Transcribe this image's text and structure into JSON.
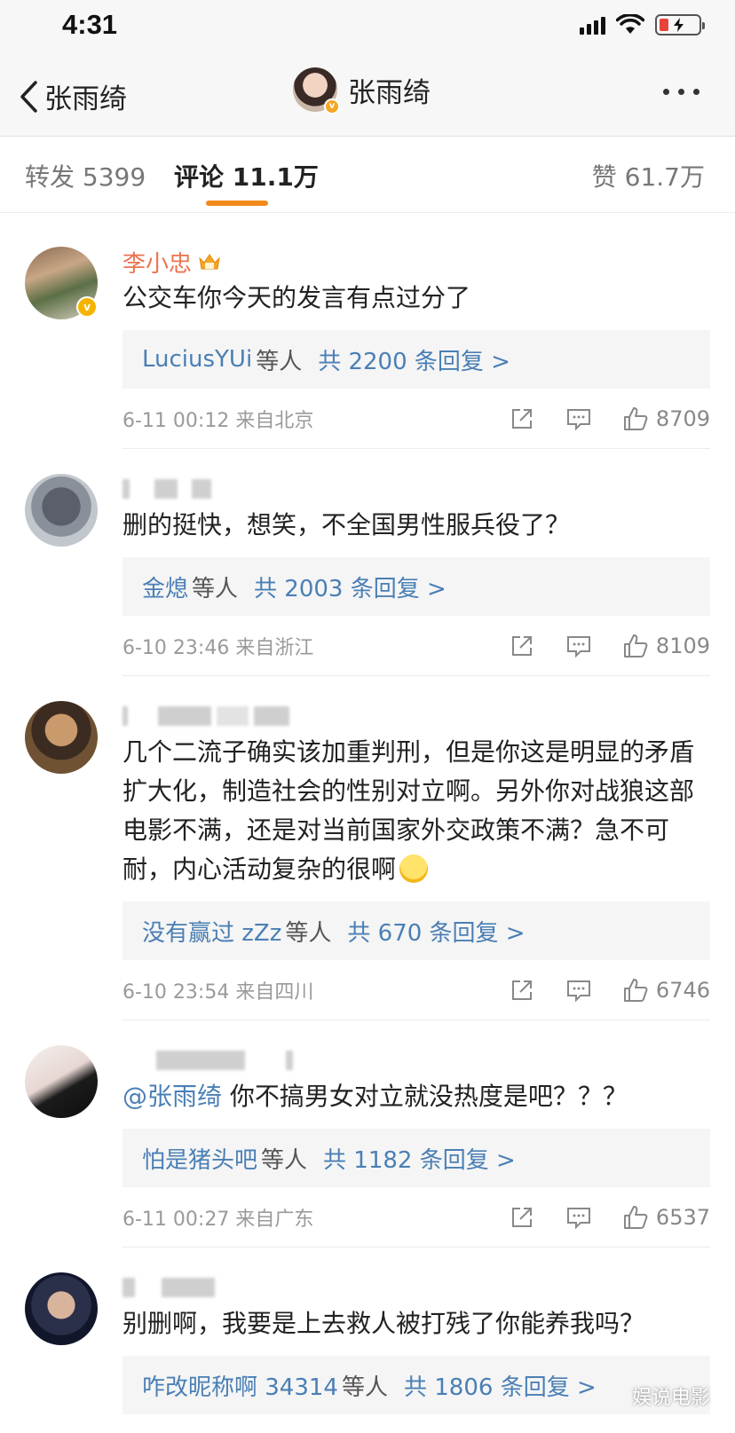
{
  "status_bar": {
    "time": "4:31"
  },
  "nav": {
    "back_label": "张雨绮",
    "title": "张雨绮"
  },
  "tabs": {
    "repost": "转发 5399",
    "comments": "评论 11.1万",
    "likes": "赞 61.7万"
  },
  "comments": [
    {
      "username": "李小忠",
      "text": "公交车你今天的发言有点过分了",
      "reply_users": "LuciusYUi",
      "reply_suffix": "等人",
      "reply_count": "共 2200 条回复 >",
      "time": "6-11 00:12  来自北京",
      "likes": "8709"
    },
    {
      "text": "删的挺快，想笑，不全国男性服兵役了？",
      "reply_users": "金熄",
      "reply_suffix": "等人",
      "reply_count": "共 2003 条回复 >",
      "time": "6-10 23:46  来自浙江",
      "likes": "8109"
    },
    {
      "text": "几个二流子确实该加重判刑，但是你这是明显的矛盾扩大化，制造社会的性别对立啊。另外你对战狼这部电影不满，还是对当前国家外交政策不满？急不可耐，内心活动复杂的很啊",
      "reply_users": "没有赢过 zZz",
      "reply_suffix": "等人",
      "reply_count": "共 670 条回复 >",
      "time": "6-10 23:54  来自四川",
      "likes": "6746"
    },
    {
      "mention": "@张雨绮",
      "text": " 你不搞男女对立就没热度是吧？？？",
      "reply_users": "怕是猪头吧",
      "reply_suffix": "等人",
      "reply_count": "共 1182 条回复 >",
      "time": "6-11 00:27  来自广东",
      "likes": "6537"
    },
    {
      "text": "别删啊，我要是上去救人被打残了你能养我吗？",
      "reply_users": "咋改昵称啊 34314",
      "reply_suffix": "等人",
      "reply_count": "共 1806 条回复 >"
    }
  ],
  "watermark": "娱说电影"
}
